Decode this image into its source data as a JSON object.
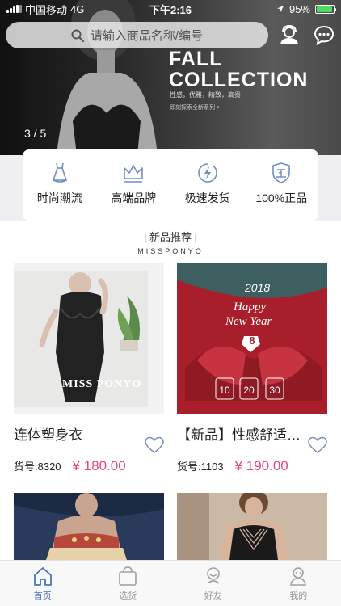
{
  "status_bar": {
    "carrier": "中国移动",
    "network": "4G",
    "time": "下午2:16",
    "battery": "95%"
  },
  "search": {
    "placeholder": "请输入商品名称/编号"
  },
  "banner": {
    "title_line1": "FALL",
    "title_line2": "COLLECTION",
    "subtitle": "性感，优雅，精致，高贵",
    "link": "即刻探索全新系列 >",
    "pager": "3 / 5"
  },
  "features": [
    {
      "label": "时尚潮流",
      "icon": "dress-icon"
    },
    {
      "label": "高端品牌",
      "icon": "crown-icon"
    },
    {
      "label": "极速发货",
      "icon": "lightning-icon"
    },
    {
      "label": "100%正品",
      "icon": "shield-icon"
    }
  ],
  "section": {
    "title": "| 新品推荐 |",
    "subtitle": "MISSPONYO"
  },
  "products": [
    {
      "name": "连体塑身衣",
      "sku": "货号:8320",
      "price": "¥ 180.00",
      "image_text": "MISS PONYO"
    },
    {
      "name": "【新品】性感舒适…",
      "sku": "货号:1103",
      "price": "¥ 190.00",
      "image_text": {
        "year": "2018",
        "happy": "Happy",
        "new_year": "New Year",
        "badge": "8",
        "d1": "10",
        "d2": "20",
        "d3": "30"
      }
    },
    {
      "name": "",
      "sku": "",
      "price": ""
    },
    {
      "name": "",
      "sku": "",
      "price": ""
    }
  ],
  "tabs": [
    {
      "label": "首页",
      "icon": "home-icon",
      "active": true
    },
    {
      "label": "选货",
      "icon": "bag-icon",
      "active": false
    },
    {
      "label": "好友",
      "icon": "friends-icon",
      "active": false
    },
    {
      "label": "我的",
      "icon": "profile-icon",
      "active": false
    }
  ],
  "colors": {
    "accent": "#4a73b8",
    "price": "#e54a77",
    "icon_blue": "#6f8fc7"
  }
}
